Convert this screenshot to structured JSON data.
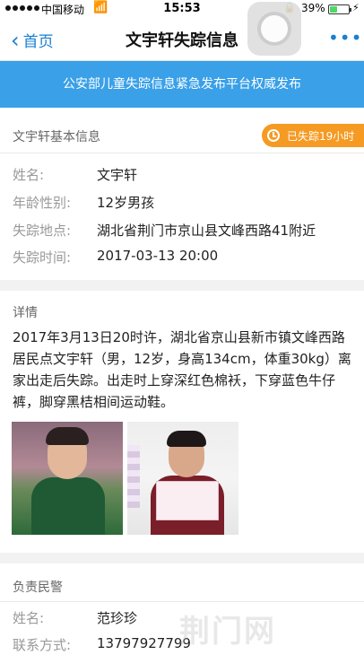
{
  "status_bar": {
    "carrier": "中国移动",
    "time": "15:53",
    "battery_percent": "39%",
    "battery_level": 0.39
  },
  "nav": {
    "back_label": "首页",
    "title": "文宇轩失踪信息",
    "more_label": "•••"
  },
  "banner": {
    "text": "公安部儿童失踪信息紧急发布平台权威发布"
  },
  "basic_info": {
    "heading": "文宇轩基本信息",
    "missing_badge": "已失踪19小时",
    "fields": [
      {
        "label": "姓名:",
        "value": "文宇轩"
      },
      {
        "label": "年龄性别:",
        "value": "12岁男孩"
      },
      {
        "label": "失踪地点:",
        "value": "湖北省荆门市京山县文峰西路41附近"
      },
      {
        "label": "失踪时间:",
        "value": "2017-03-13 20:00"
      }
    ]
  },
  "details": {
    "heading": "详情",
    "text": "2017年3月13日20时许，湖北省京山县新市镇文峰西路居民点文宇轩（男，12岁，身高134cm，体重30kg）离家出走后失踪。出走时上穿深红色棉袄，下穿蓝色牛仔裤，脚穿黑桔相间运动鞋。"
  },
  "officer": {
    "heading": "负责民警",
    "fields": [
      {
        "label": "姓名:",
        "value": "范珍珍"
      },
      {
        "label": "联系方式:",
        "value": "13797927799"
      }
    ]
  },
  "watermark": "荆门网",
  "colors": {
    "accent": "#1a7fd0",
    "banner": "#3aa0e8",
    "badge": "#f59a23"
  }
}
